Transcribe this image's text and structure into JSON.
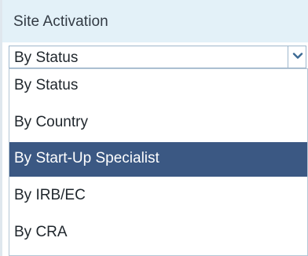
{
  "panel": {
    "title": "Site Activation"
  },
  "select": {
    "value": "By Status",
    "icon": "chevron-down-icon"
  },
  "dropdown": {
    "options": [
      {
        "label": "By Status",
        "selected": false
      },
      {
        "label": "By Country",
        "selected": false
      },
      {
        "label": "By Start-Up Specialist",
        "selected": true
      },
      {
        "label": "By IRB/EC",
        "selected": false
      },
      {
        "label": "By CRA",
        "selected": false
      }
    ]
  },
  "colors": {
    "header_bg": "#e3f1f8",
    "selected_bg": "#3b5883",
    "border": "#9fb7cc",
    "chevron": "#3c6a94"
  }
}
